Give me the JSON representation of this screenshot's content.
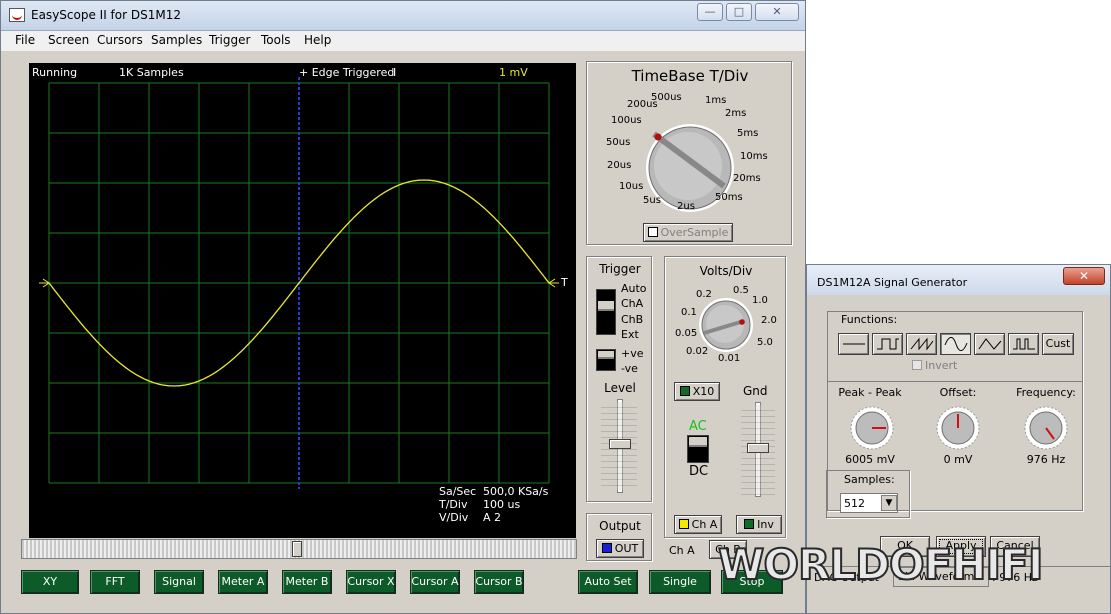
{
  "window": {
    "title": "EasyScope II for DS1M12",
    "buttons": {
      "minimize": "—",
      "maximize": "□",
      "close": "✕"
    }
  },
  "menu": [
    "File",
    "Screen",
    "Cursors",
    "Samples",
    "Trigger",
    "Tools",
    "Help"
  ],
  "scope": {
    "status": "Running",
    "samples": "1K Samples",
    "trigger": "+ Edge Triggered",
    "cursor_mark": "I",
    "scale": "1 mV",
    "trigger_marker": "T",
    "readout": {
      "sa_sec_label": "Sa/Sec",
      "sa_sec_value": "500,0 KSa/s",
      "tdiv_label": "T/Div",
      "tdiv_value": "100 us",
      "vdiv_label": "V/Div",
      "vdiv_value": "A 2"
    },
    "trace_color": "#e8e830",
    "grid_color": "#1c7a1c",
    "axis_color": "#2a3ad0"
  },
  "timebase": {
    "title": "TimeBase T/Div",
    "labels": [
      "500us",
      "1ms",
      "2ms",
      "5ms",
      "10ms",
      "20ms",
      "50ms",
      "2us",
      "5us",
      "10us",
      "20us",
      "50us",
      "100us",
      "200us"
    ],
    "oversample_label": "OverSample"
  },
  "trigger": {
    "title": "Trigger",
    "sources": [
      "Auto",
      "ChA",
      "ChB",
      "Ext"
    ],
    "slopes": [
      "+ve",
      "-ve"
    ],
    "level_label": "Level"
  },
  "volts": {
    "title": "Volts/Div",
    "labels": [
      "0.5",
      "1.0",
      "2.0",
      "5.0",
      "0.01",
      "0.02",
      "0.05",
      "0.1",
      "0.2"
    ],
    "x10_label": "X10",
    "gnd_label": "Gnd",
    "ac_label": "AC",
    "dc_label": "DC",
    "cha_label": "Ch A",
    "inv_label": "Inv"
  },
  "output": {
    "title": "Output",
    "out_label": "OUT"
  },
  "channel_tabs": [
    "Ch A",
    "Ch B"
  ],
  "bottom_buttons": [
    "XY",
    "FFT",
    "Signal",
    "Meter A",
    "Meter B",
    "Cursor X",
    "Cursor A",
    "Cursor B",
    "Auto Set",
    "Single",
    "Stop"
  ],
  "siggen": {
    "title": "DS1M12A Signal Generator",
    "close": "✕",
    "functions_label": "Functions:",
    "cust_label": "Cust",
    "invert_label": "Invert",
    "peak_label": "Peak - Peak",
    "peak_value": "6005 mV",
    "offset_label": "Offset:",
    "offset_value": "0 mV",
    "freq_label": "Frequency:",
    "freq_value": "976 Hz",
    "samples_label": "Samples:",
    "samples_value": "512",
    "ok_label": "OK",
    "apply_label": "Apply",
    "cancel_label": "Cancel",
    "dac_label": "DAC Output",
    "waveform_label": "Sin Waveform",
    "freq_readout": ": 976 Hz"
  },
  "watermark": "WORLDOFHIFI"
}
